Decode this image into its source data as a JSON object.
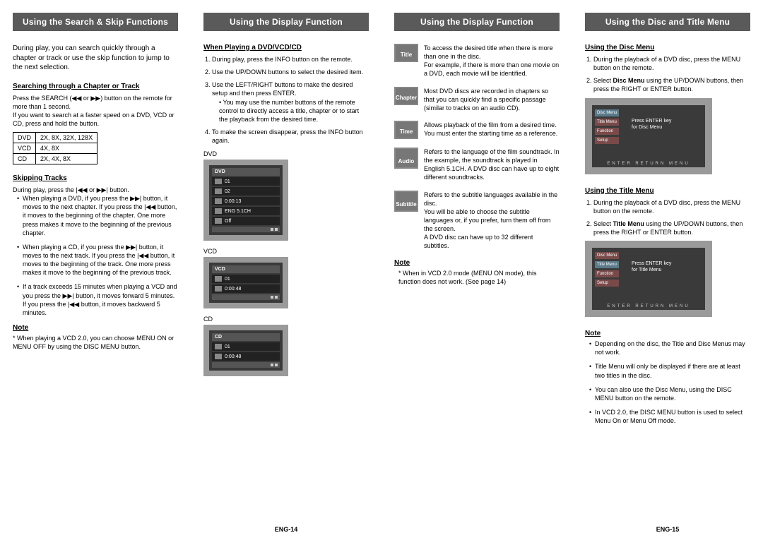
{
  "col1": {
    "header": "Using the Search & Skip Functions",
    "intro": "During play, you can search quickly through a chapter or track or use the skip function to jump to the next selection.",
    "search_h": "Searching through a Chapter or Track",
    "search_p1a": "Press the SEARCH (",
    "search_p1b": " or ",
    "search_p1c": ") button on the remote for more than 1 second.",
    "search_p2": "If you want to search at a faster speed on a DVD, VCD or CD, press and hold the button.",
    "table": {
      "r1a": "DVD",
      "r1b": "2X, 8X, 32X, 128X",
      "r2a": "VCD",
      "r2b": "4X, 8X",
      "r3a": "CD",
      "r3b": "2X, 4X, 8X"
    },
    "skip_h": "Skipping Tracks",
    "skip_p_a": "During play, press the ",
    "skip_p_b": " or ",
    "skip_p_c": " button.",
    "b1a": "When playing a DVD, if you press the ",
    "b1b": " button, it moves to the next chapter. If you press the ",
    "b1c": " button, it moves to the beginning of the chapter. One more press makes it move to the beginning of the previous chapter.",
    "b2a": "When playing a CD, if you press the ",
    "b2b": " button, it moves to the next track. If you press the ",
    "b2c": " button, it moves to the beginning of the track. One more press makes it move to the beginning of the previous track.",
    "b3a": "If a track exceeds 15 minutes when playing a VCD and you press the ",
    "b3b": " button, it moves forward 5 minutes. If you press the ",
    "b3c": " button, it moves backward 5 minutes.",
    "note_h": "Note",
    "note_t": "* When playing a VCD 2.0, you can choose MENU ON or MENU OFF by using the DISC MENU button."
  },
  "col2": {
    "header": "Using the Display Function",
    "sub": "When Playing a DVD/VCD/CD",
    "li1": "During play, press the INFO button on the remote.",
    "li2": "Use the UP/DOWN buttons to select the desired item.",
    "li3": "Use the LEFT/RIGHT buttons to make the desired setup and then press ENTER.",
    "li3s": "You may use the number buttons of the remote control to directly access a title, chapter or to start the playback from the desired time.",
    "li4": "To make the screen disappear, press the INFO button again.",
    "lbl_dvd": "DVD",
    "lbl_vcd": "VCD",
    "lbl_cd": "CD",
    "osd_dvd": {
      "top": "DVD",
      "r1": "01",
      "r2": "02",
      "r3": "0:00:13",
      "r4": "ENG 5.1CH",
      "r5": "Off"
    },
    "osd_vcd": {
      "top": "VCD",
      "r1": "01",
      "r2": "0:00:48"
    },
    "osd_cd": {
      "top": "CD",
      "r1": "01",
      "r2": "0:00:48"
    }
  },
  "col3": {
    "header": "Using the Display Function",
    "defs": {
      "title_l": "Title",
      "title_t": "To access the desired title when there is more than one in the disc.\nFor example, if there is more than one movie on a DVD, each movie will be identified.",
      "chapter_l": "Chapter",
      "chapter_t": "Most DVD discs are recorded in chapters so that you can quickly find a specific passage (similar to tracks on an audio CD).",
      "time_l": "Time",
      "time_t": "Allows playback of the film from a desired time. You must enter the starting time as a reference.",
      "audio_l": "Audio",
      "audio_t": "Refers to the language of the film soundtrack. In the example, the soundtrack is played in English 5.1CH. A DVD disc can have up to eight different soundtracks.",
      "sub_l": "Subtitle",
      "sub_t": "Refers to the subtitle languages available in the disc.\nYou will be able to choose the subtitle languages or, if you prefer, turn them off from the screen.\nA DVD disc can have up to 32 different subtitles."
    },
    "note_h": "Note",
    "note_t": "* When in VCD 2.0 mode (MENU ON mode), this function does not work. (See page 14)"
  },
  "col4": {
    "header": "Using the Disc and Title Menu",
    "disc_h": "Using the Disc Menu",
    "disc_li1": "During the playback of a DVD disc, press the MENU button on the remote.",
    "disc_li2a": "Select ",
    "disc_li2b": "Disc Menu",
    "disc_li2c": " using the UP/DOWN buttons, then press the RIGHT or ENTER button.",
    "tv1_msg_a": "Press ENTER key",
    "tv1_msg_b": "for Disc Menu",
    "title_h": "Using the Title Menu",
    "title_li1": "During the playback of a DVD disc, press the MENU button on the remote.",
    "title_li2a": "Select ",
    "title_li2b": "Title Menu",
    "title_li2c": " using the UP/DOWN buttons, then press the RIGHT or ENTER button.",
    "tv2_msg_a": "Press ENTER key",
    "tv2_msg_b": "for Title Menu",
    "tv_labels": {
      "a": "Disc Menu",
      "b": "Title Menu",
      "c": "Function",
      "d": "Setup"
    },
    "tv_bottom": "ENTER   RETURN   MENU",
    "note_h": "Note",
    "n1": "Depending on the disc, the Title and Disc Menus may not work.",
    "n2": "Title Menu will only be displayed if there are at least two titles in the disc.",
    "n3": "You can also use the Disc Menu, using the DISC MENU button on the remote.",
    "n4": "In VCD 2.0, the DISC MENU button is used to select Menu On or Menu Off mode."
  },
  "footer_left": "ENG-14",
  "footer_right": "ENG-15"
}
